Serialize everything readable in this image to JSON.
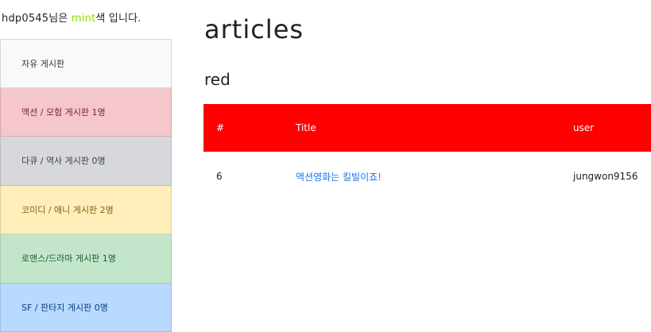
{
  "greeting": {
    "prefix": "hdp0545님은 ",
    "color_word": "mint",
    "suffix": "색 입니다.",
    "accent": "#8ee000"
  },
  "sidebar": {
    "items": [
      {
        "label": "자유 게시판"
      },
      {
        "label": "액션 / 모험 게시판 1명"
      },
      {
        "label": "다큐 / 역사 게시판 0명"
      },
      {
        "label": "코미디 / 애니 게시판 2명"
      },
      {
        "label": "로맨스/드라마 게시판 1명"
      },
      {
        "label": "SF / 판타지 게시판 0명"
      }
    ]
  },
  "main": {
    "title": "articles",
    "subtitle": "red",
    "header_color": "#ff0000"
  },
  "table": {
    "headers": [
      "#",
      "Title",
      "user"
    ],
    "rows": [
      {
        "num": "6",
        "title": "액션영화는 킬빌이죠!",
        "user": "jungwon9156"
      }
    ]
  }
}
